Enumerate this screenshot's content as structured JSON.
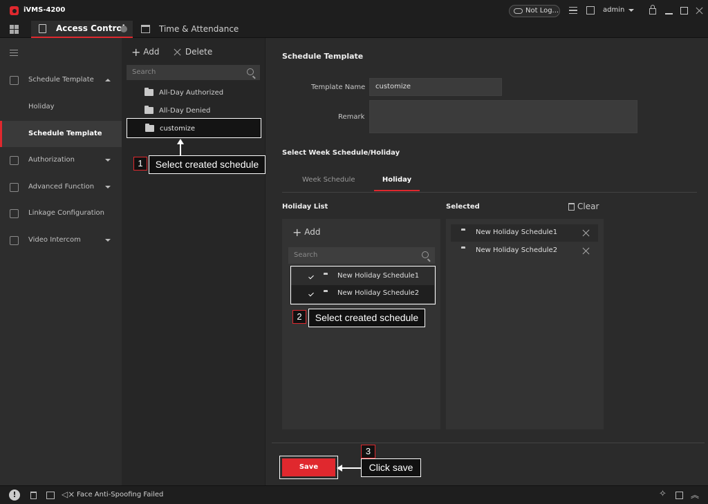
{
  "app": {
    "title": "iVMS-4200",
    "cloud_status": "Not Log...",
    "user": "admin"
  },
  "tabs": [
    {
      "label": "Access Control"
    },
    {
      "label": "Time & Attendance"
    }
  ],
  "nav": {
    "items": [
      {
        "label": "Schedule Template"
      },
      {
        "label": "Holiday"
      },
      {
        "label": "Schedule Template"
      },
      {
        "label": "Authorization"
      },
      {
        "label": "Advanced Function"
      },
      {
        "label": "Linkage Configuration"
      },
      {
        "label": "Video Intercom"
      }
    ]
  },
  "tree": {
    "add_label": "Add",
    "delete_label": "Delete",
    "search_placeholder": "Search",
    "items": [
      {
        "label": "All-Day Authorized"
      },
      {
        "label": "All-Day Denied"
      },
      {
        "label": "customize"
      }
    ]
  },
  "main": {
    "section_title": "Schedule Template",
    "template_name_label": "Template Name",
    "template_name_value": "customize",
    "remark_label": "Remark",
    "select_title": "Select Week Schedule/Holiday",
    "tabs": [
      {
        "label": "Week Schedule"
      },
      {
        "label": "Holiday"
      }
    ],
    "holiday_list_title": "Holiday List",
    "selected_title": "Selected",
    "clear_label": "Clear",
    "add_label": "Add",
    "search_placeholder": "Search",
    "holiday_items": [
      {
        "label": "New Holiday Schedule1"
      },
      {
        "label": "New Holiday Schedule2"
      }
    ],
    "selected_items": [
      {
        "label": "New Holiday Schedule1"
      },
      {
        "label": "New Holiday Schedule2"
      }
    ],
    "save_label": "Save"
  },
  "annotations": [
    {
      "number": "1",
      "text": "Select created schedule"
    },
    {
      "number": "2",
      "text": "Select created schedule"
    },
    {
      "number": "3",
      "text": "Click save"
    }
  ],
  "status": {
    "message": "Face Anti-Spoofing Failed"
  },
  "colors": {
    "accent": "#e0282e",
    "background": "#2b2b2b"
  }
}
